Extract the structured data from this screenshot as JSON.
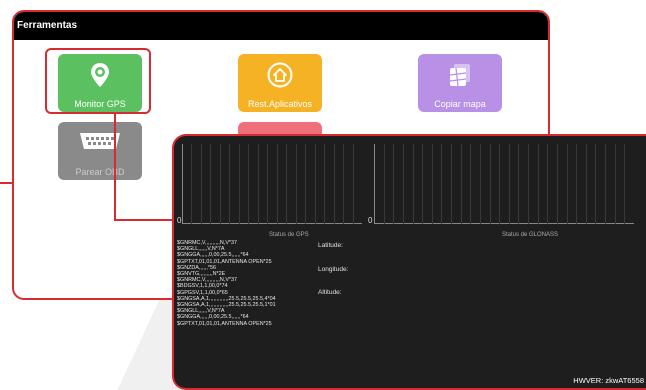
{
  "tools": {
    "title": "Ferramentas",
    "tiles": [
      {
        "label": "Monitor GPS",
        "icon": "location-pin-icon"
      },
      {
        "label": "Rest.Aplicativos",
        "icon": "home-restore-icon"
      },
      {
        "label": "Copiar mapa",
        "icon": "map-copy-icon"
      },
      {
        "label": "Parear OBD",
        "icon": "obd-connector-icon"
      },
      {
        "label": "",
        "icon": "pink-tool-icon"
      }
    ]
  },
  "gps": {
    "gps_zero": "0",
    "glonass_zero": "0",
    "gps_status_label": "Status de GPS",
    "glonass_status_label": "Status de GLONASS",
    "nmea_lines": [
      "$GNRMC,V,,,,,,,,,,N,V*37",
      "$GNGLL,,,,,,V,N*7A",
      "$GNGGA,,,,,,0,00,25.5,,,,,,*64",
      "$GPTXT,01,01,01,ANTENNA OPEN*25",
      "$GNZDA,,,,,,*56",
      "$GNVTG,,,,,,,,,N*2E",
      "$GNRMC,V,,,,,,,,,,N,V*37",
      "$BDGSV,1,1,00,0*74",
      "$GPGSV,1,1,00,0*65",
      "$GNGSA,A,1,,,,,,,,,,,,,25.5,25.5,25.5,4*04",
      "$GNGSA,A,1,,,,,,,,,,,,,25.5,25.5,25.5,1*01",
      "$GNGLL,,,,,,V,N*7A",
      "$GNGGA,,,,,,0,00,25.5,,,,,,*64",
      "$GPTXT,01,01,01,ANTENNA OPEN*25"
    ],
    "latitude_label": "Latitude:",
    "longitude_label": "Longitude:",
    "altitude_label": "Altitude:",
    "hwver": "HWVER: zkwAT6558"
  },
  "colors": {
    "accent_red": "#d62b30",
    "gps_tile": "#5bc160",
    "rest_tile": "#f5b225",
    "map_tile": "#b890e6",
    "obd_tile": "#8a8a8a"
  }
}
